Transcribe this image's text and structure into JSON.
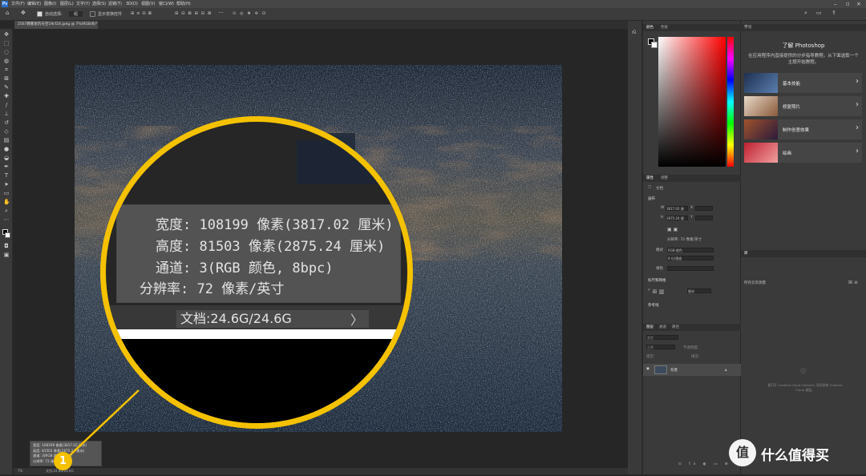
{
  "menubar": {
    "logo": "Ps",
    "items": [
      "文件(F)",
      "编辑(E)",
      "图像(I)",
      "图层(L)",
      "文字(Y)",
      "选择(S)",
      "滤镜(T)",
      "3D(D)",
      "视图(V)",
      "窗口(W)",
      "帮助(H)"
    ]
  },
  "options": {
    "auto_select": "自动选择:",
    "auto_select_value": "组",
    "show_transform": "显示变换控件"
  },
  "document_tab": {
    "label": "2567颗繁星的天空19cf24.jpeg @ 7%(RGB/8)*"
  },
  "status": {
    "zoom": "7%",
    "info": "文档:24.6G/24.6G"
  },
  "info_small": {
    "lines": [
      "宽度: 108199 像素(3817.02 厘米)",
      "高度: 81503 像素(2875.24 厘米)",
      "通道: 3(RGB 颜色, 8bpc)",
      "分辨率: 72 像素/英寸"
    ]
  },
  "magnifier": {
    "width_line": "宽度: 108199 像素(3817.02 厘米)",
    "height_line": "高度: 81503 像素(2875.24 厘米)",
    "channels_line": "通道: 3(RGB 颜色, 8bpc)",
    "resolution_line": "分辨率: 72 像素/英寸",
    "doc_line": "文档:24.6G/24.6G",
    "chevron": "〉"
  },
  "badge": {
    "number": "1"
  },
  "panels": {
    "color_tabs": [
      "颜色",
      "色板"
    ],
    "properties_tabs": [
      "属性",
      "调整"
    ],
    "doc_label": "文档",
    "canvas_section": "画布",
    "W_label": "W",
    "W_value": "3817.02 厘",
    "H_label": "H",
    "H_value": "2875.24 厘",
    "X_label": "X",
    "Y_label": "Y",
    "resolution": "分辨率: 72 像素/英寸",
    "mode_label": "模式",
    "mode_value": "RGB 颜色",
    "depth_value": "8 位/通道",
    "fill_label": "填色",
    "rulers_section": "标尺和网格",
    "rulers_unit": "厘米",
    "guides_section": "参考线",
    "layers_tabs": [
      "图层",
      "通道",
      "路径"
    ],
    "layer_kind": "类型",
    "blend_mode": "正常",
    "opacity_label": "不透明度:",
    "lock_label": "锁定:",
    "fill_short": "填充:",
    "layer_name": "背景"
  },
  "learn": {
    "tab": "学习",
    "title": "了解 Photoshop",
    "desc": "在应用程序内直接提供的分步指导教程。从下面选取一个主题开始教程。",
    "cards": [
      "基本技能",
      "修复照片",
      "制作创意效果",
      "绘画"
    ],
    "lib_tab": "库",
    "lib_select": "所有云资源量",
    "cc_note": "要打开 Creative Cloud Libraries, 您须安装 Creative Cloud 桌面。"
  },
  "watermark": {
    "logo": "值",
    "text": "什么值得买"
  }
}
